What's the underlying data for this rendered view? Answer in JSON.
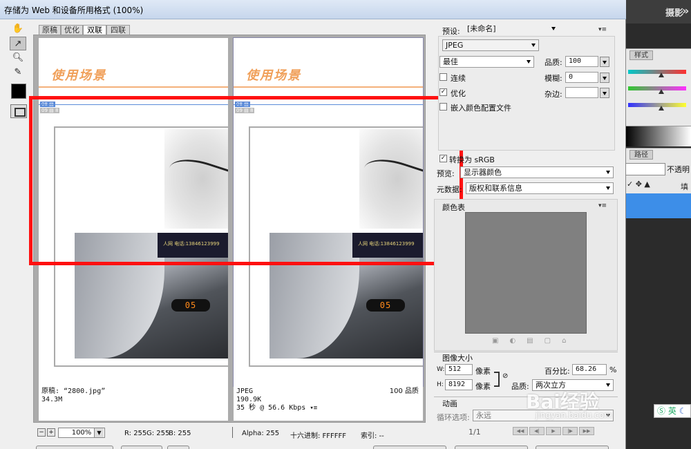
{
  "window": {
    "title": "存储为 Web 和设备所用格式 (100%)"
  },
  "view_tabs": [
    "原稿",
    "优化",
    "双联",
    "四联"
  ],
  "active_view_tab": "双联",
  "document": {
    "heading": "使用场景",
    "photo_sign_text": "人网  电话:13846123999",
    "led_text": "05"
  },
  "panes": [
    {
      "line1": "原稿: “2800.jpg”",
      "line2": "34.3M"
    },
    {
      "line1": "JPEG",
      "line1_right": "100 品质",
      "line2": "190.9K",
      "line3": "35 秒 @ 56.6 Kbps"
    }
  ],
  "status": {
    "zoom": "100%",
    "r": "R: 255",
    "g": "G: 255",
    "b": "B: 255",
    "alpha": "Alpha: 255",
    "hex": "十六进制: FFFFFF",
    "index": "索引: --"
  },
  "settings": {
    "preset_label": "预设:",
    "preset_value": "[未命名]",
    "format": "JPEG",
    "quality_preset": "最佳",
    "quality_label": "品质:",
    "quality_value": "100",
    "progressive_label": "连续",
    "blur_label": "模糊:",
    "blur_value": "0",
    "optimized_label": "优化",
    "matte_label": "杂边:",
    "embed_label": "嵌入颜色配置文件",
    "srgb_label": "转换为 sRGB",
    "preview_label": "预览:",
    "preview_value": "显示器颜色",
    "metadata_label": "元数据:",
    "metadata_value": "版权和联系信息",
    "color_table_label": "颜色表",
    "image_size_label": "图像大小",
    "w_label": "W:",
    "w_value": "512",
    "h_label": "H:",
    "h_value": "8192",
    "px_label": "像素",
    "percent_label": "百分比:",
    "percent_value": "68.26",
    "percent_unit": "%",
    "quality2_label": "品质:",
    "quality2_value": "两次立方",
    "animation_label": "动画",
    "loop_label": "循环选项:",
    "loop_value": "永远",
    "frame_counter": "1/1"
  },
  "ps_panel": {
    "top_label": "摄影",
    "styles_tab": "样式",
    "paths_tab": "路径",
    "opacity_label": "不透明",
    "fill_label": "填"
  },
  "watermark": {
    "brand": "Bai经验",
    "url": "jingyan.baidu.com"
  },
  "ime": {
    "text": "英"
  },
  "colors": {
    "highlight": "#ff1010",
    "doc_heading": "#f0a05a",
    "slice_blue": "#5a8ad8",
    "selection_blue": "#3d8ee8"
  }
}
